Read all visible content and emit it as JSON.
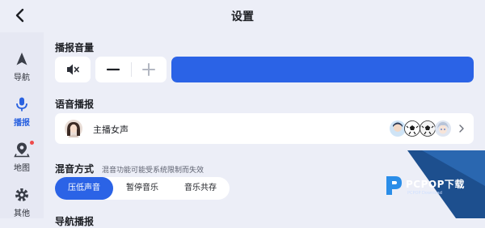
{
  "header": {
    "title": "设置"
  },
  "sidebar": {
    "items": [
      {
        "label": "导航",
        "icon": "navigation-arrow-icon",
        "active": false
      },
      {
        "label": "播报",
        "icon": "microphone-icon",
        "active": true
      },
      {
        "label": "地图",
        "icon": "map-pin-icon",
        "active": false,
        "badge": true
      },
      {
        "label": "其他",
        "icon": "gear-icon",
        "active": false
      }
    ]
  },
  "volume": {
    "title": "播报音量",
    "mute_icon": "speaker-mute-icon",
    "minus_icon": "minus-icon",
    "plus_icon": "plus-icon",
    "level": 1.0
  },
  "voice": {
    "title": "语音播报",
    "selected_name": "主播女声",
    "more_icons": [
      "cartoon-avatar-icon",
      "soccer-ball-icon",
      "soccer-ball-icon",
      "anime-avatar-icon"
    ]
  },
  "mix": {
    "title": "混音方式",
    "note": "混音功能可能受系统限制而失效",
    "options": [
      "压低声音",
      "暂停音乐",
      "音乐共存"
    ],
    "selected_index": 0
  },
  "next_section": {
    "title": "导航播报"
  },
  "watermark": {
    "text": "PCPOP下载",
    "sub": "PCPOP Download"
  },
  "colors": {
    "accent": "#2b63e6",
    "background": "#eceef7",
    "badge": "#ef4b4b"
  }
}
